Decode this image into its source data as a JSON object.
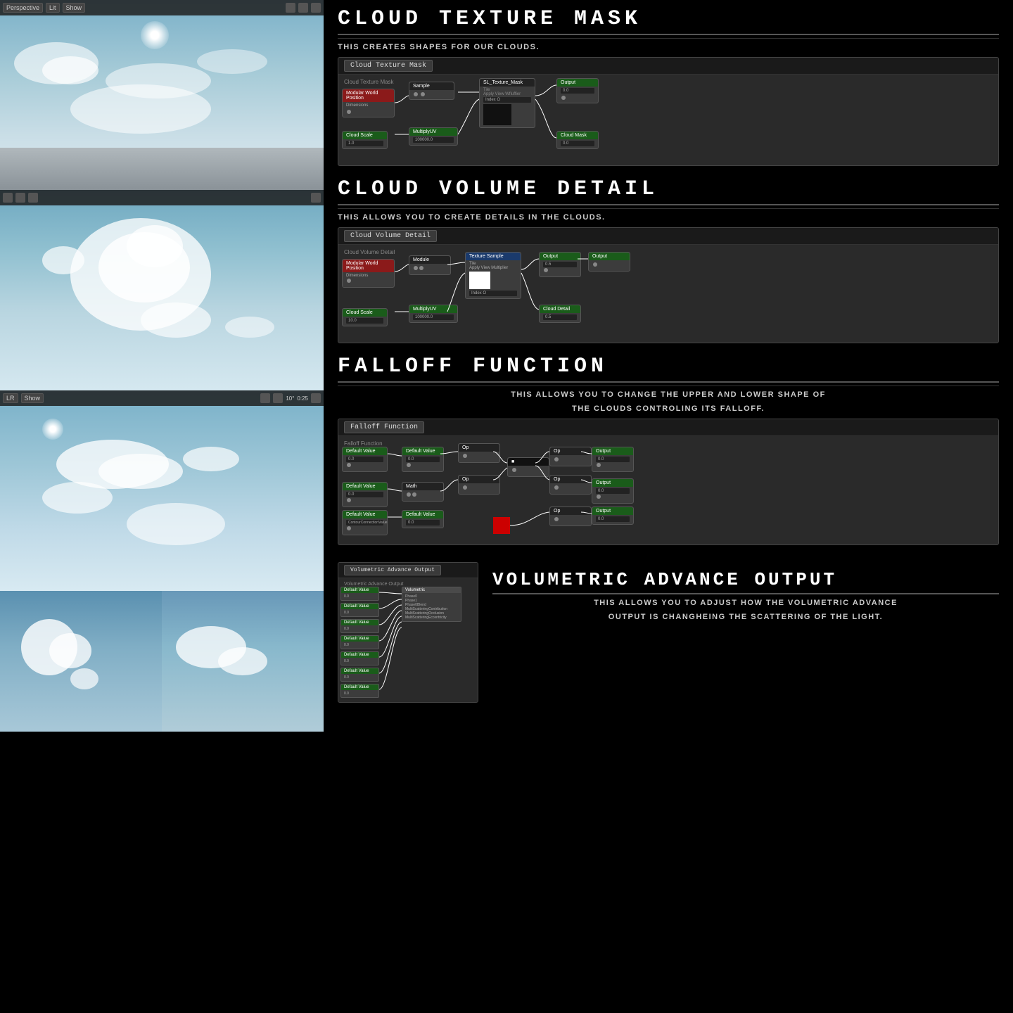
{
  "sections": {
    "cloud_texture_mask": {
      "title": "CLOUD  TEXTURE  MASK",
      "subtitle": "THIS CREATES SHAPES FOR OUR CLOUDS.",
      "badge": "Cloud Texture Mask",
      "graph_label": "Cloud Texture Mask"
    },
    "cloud_volume_detail": {
      "title": "CLOUD  VOLUME  DETAIL",
      "subtitle": "THIS ALLOWS YOU TO CREATE DETAILS IN THE CLOUDS.",
      "badge": "Cloud Volume Detail",
      "graph_label": "Cloud Volume Detail"
    },
    "falloff_function": {
      "title": "FALLOFF  FUNCTION",
      "subtitle": "THIS ALLOWS YOU TO CHANGE THE UPPER AND LOWER SHAPE OF",
      "subtitle2": "THE CLOUDS  CONTROLING ITS FALLOFF.",
      "badge": "Falloff Function",
      "graph_label": "Falloff Function"
    },
    "volumetric_advance_output": {
      "title": "VOLUMETRIC  ADVANCE  OUTPUT",
      "subtitle": "THIS ALLOWS YOU TO ADJUST HOW THE VOLUMETRIC ADVANCE",
      "subtitle2": "OUTPUT IS CHANGHEING THE SCATTERING OF THE LIGHT.",
      "badge": "Volumetric Advance Output",
      "graph_label": "Volumetric Advance Output"
    }
  },
  "viewport_labels": {
    "perspective": "Perspective",
    "lit": "Lit",
    "show": "Show",
    "lr": "LR"
  }
}
